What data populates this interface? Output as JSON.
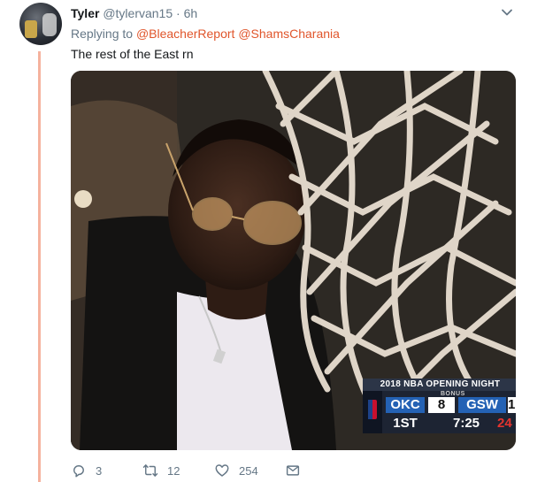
{
  "tweet": {
    "author_name": "Tyler",
    "author_handle": "@tylervan15",
    "separator": "·",
    "time": "6h",
    "replying_prefix": "Replying to",
    "mentions": [
      "@BleacherReport",
      "@ShamsCharania"
    ],
    "text": "The rest of the East rn"
  },
  "scorebug": {
    "title": "2018 NBA OPENING NIGHT",
    "bonus": "BONUS",
    "team1": "OKC",
    "score1": "8",
    "team2": "GSW",
    "score2": "1",
    "period": "1ST",
    "clock": "7:25",
    "shot_clock": "24"
  },
  "actions": {
    "replies": "3",
    "retweets": "12",
    "likes": "254"
  },
  "icons": {
    "menu": "chevron-down-icon",
    "reply": "reply-icon",
    "retweet": "retweet-icon",
    "like": "heart-icon",
    "dm": "envelope-icon"
  },
  "colors": {
    "mention": "#e0552b",
    "thread_line": "#f5b29e",
    "muted": "#657786"
  }
}
